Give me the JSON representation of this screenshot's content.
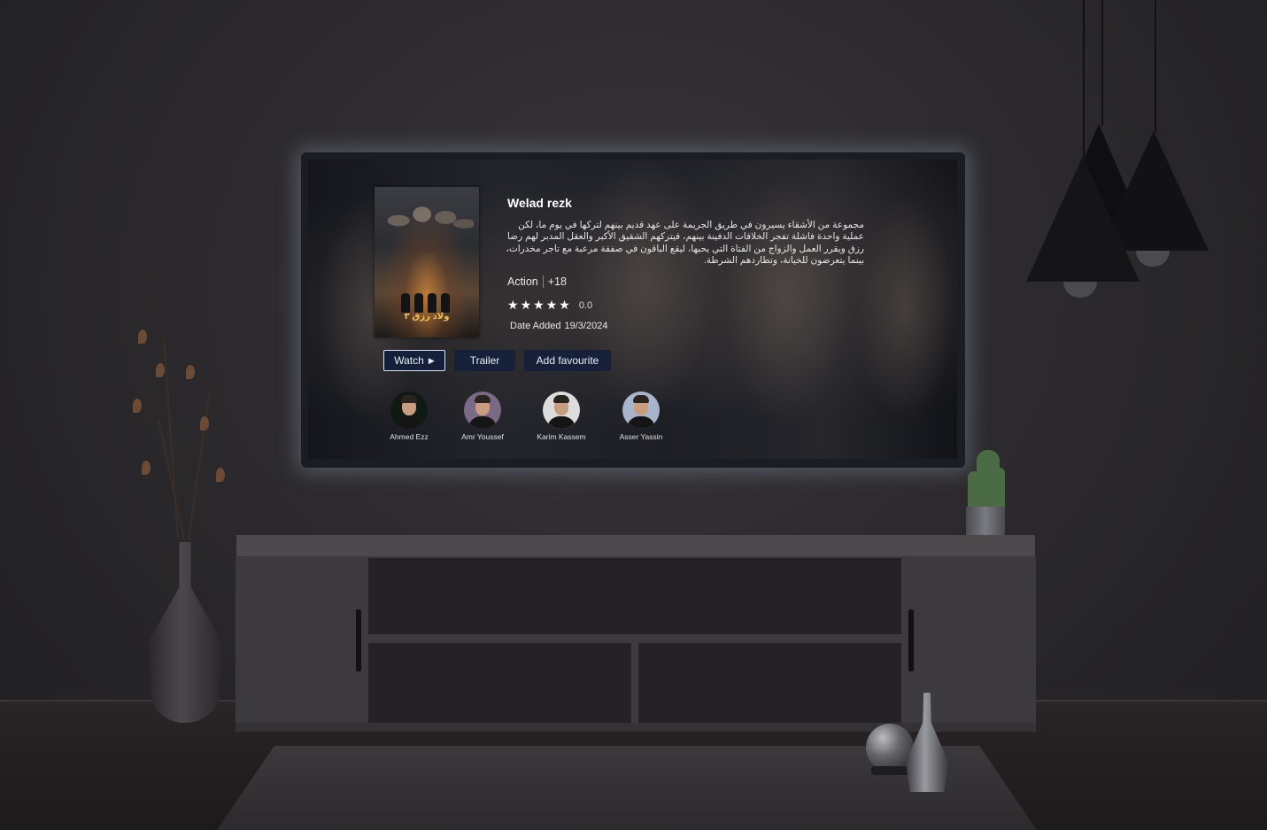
{
  "movie": {
    "title": "Welad rezk",
    "description": "مجموعة من الأشقاء يسيرون في طريق الجريمة على عهد قديم بينهم لتركها في يوم ما، لكن عملية واحدة فاشلة تفجر الخلافات الدفينة بينهم، فيتركهم الشقيق الأكبر والعقل المدبر لهم رضا رزق ويقرر العمل والزواج من الفتاة التي يحبها، ليقع الباقون في صفقة مرعبة مع تاجر مخدرات، بينما يتعرضون للخيانة، وتطاردهم الشرطة.",
    "genre": "Action",
    "age_rating": "+18",
    "stars": 5,
    "rating_value": "0.0",
    "date_label": "Date Added",
    "date_value": "19/3/2024",
    "poster_title": "ولاد رزق ٣"
  },
  "buttons": {
    "watch_label": "Watch",
    "trailer_label": "Trailer",
    "favourite_label": "Add favourite"
  },
  "cast": [
    {
      "name": "Ahmed Ezz",
      "bg": "#0f1a12"
    },
    {
      "name": "Amr Youssef",
      "bg": "#7a6a86"
    },
    {
      "name": "Karim Kassem",
      "bg": "#dcdcdc"
    },
    {
      "name": "Asser Yassin",
      "bg": "#a8b4cc"
    }
  ],
  "colors": {
    "button_bg": "#162038",
    "accent_border": "#d8e2f4",
    "wall": "#2c2a2d"
  },
  "icons": {
    "play": "play-icon",
    "star": "star-icon"
  }
}
